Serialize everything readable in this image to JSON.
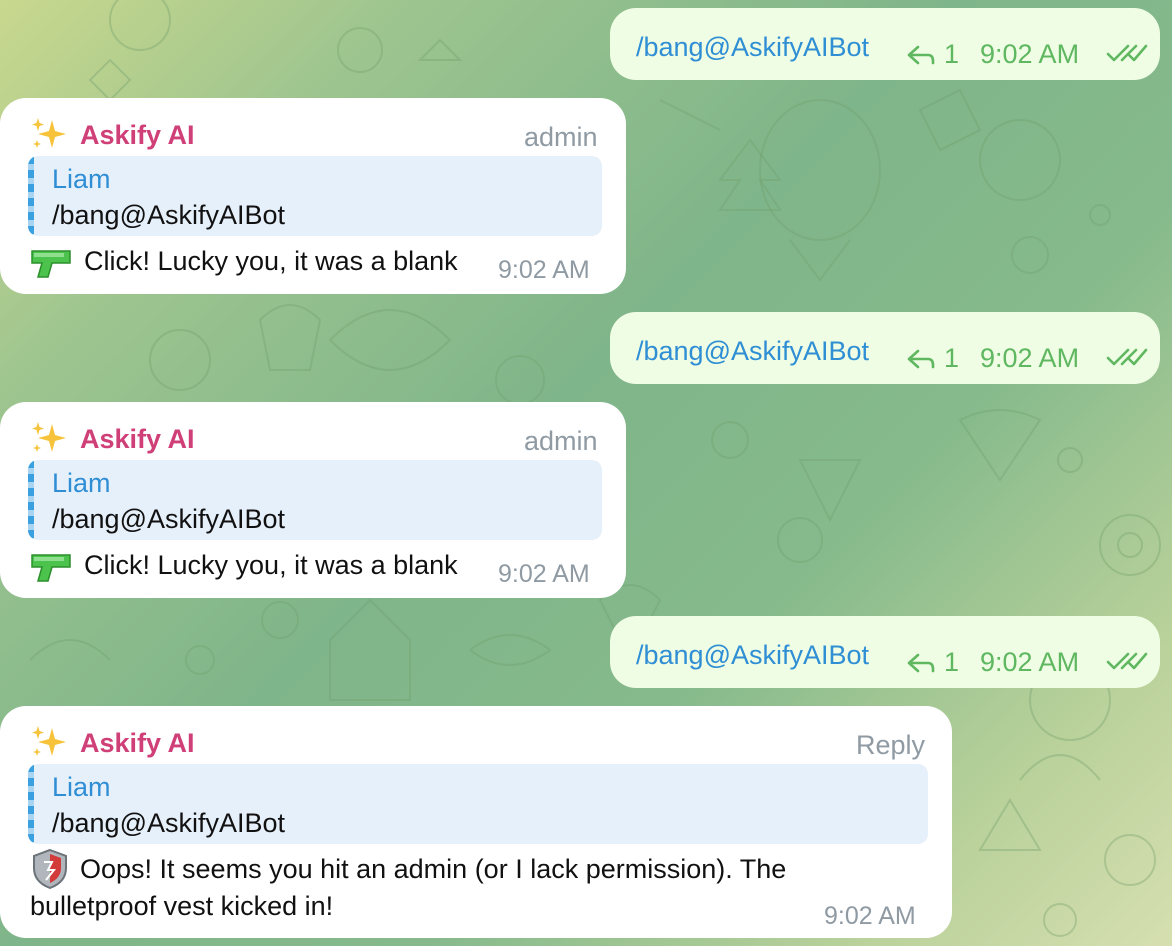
{
  "outgoing": [
    {
      "text": "/bang@AskifyAIBot",
      "reply_count": "1",
      "time": "9:02 AM"
    },
    {
      "text": "/bang@AskifyAIBot",
      "reply_count": "1",
      "time": "9:02 AM"
    },
    {
      "text": "/bang@AskifyAIBot",
      "reply_count": "1",
      "time": "9:02 AM"
    }
  ],
  "incoming": [
    {
      "sender": "Askify AI",
      "role": "admin",
      "quote_name": "Liam",
      "quote_text": "/bang@AskifyAIBot",
      "text": "Click! Lucky you, it was a blank",
      "time": "9:02 AM"
    },
    {
      "sender": "Askify AI",
      "role": "admin",
      "quote_name": "Liam",
      "quote_text": "/bang@AskifyAIBot",
      "text": "Click! Lucky you, it was a blank",
      "time": "9:02 AM"
    },
    {
      "sender": "Askify AI",
      "role": "Reply",
      "quote_name": "Liam",
      "quote_text": "/bang@AskifyAIBot",
      "text_line1": "Oops! It seems you hit an admin (or I lack permission). The",
      "text_line2": "bulletproof vest kicked in!",
      "time": "9:02 AM"
    }
  ],
  "colors": {
    "sender": "#cf3f78",
    "link": "#2f8ed4",
    "outgoing_bg": "#eefde3",
    "check": "#5fb760",
    "meta": "#8f9aa3"
  },
  "icons": {
    "sparkles": "sparkles-icon",
    "gun": "water-pistol-icon",
    "shield": "shield-icon",
    "reply": "reply-arrow-icon",
    "read": "double-check-icon"
  }
}
